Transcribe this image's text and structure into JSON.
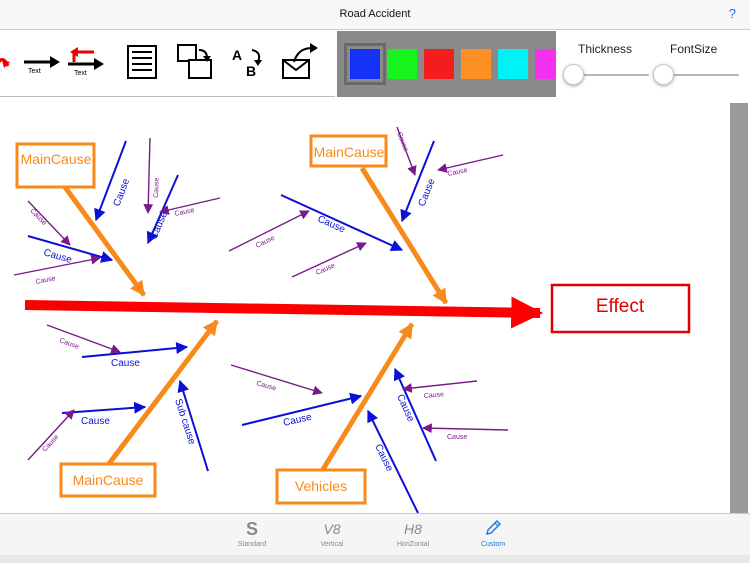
{
  "window": {
    "title": "Road Accident",
    "help": "?"
  },
  "toolbar": {
    "tools": [
      {
        "name": "red-arrow-tool"
      },
      {
        "name": "text-arrow-tool",
        "label": "Text"
      },
      {
        "name": "text-return-arrow-tool",
        "label": "Text"
      },
      {
        "name": "document-tool"
      },
      {
        "name": "resize-tool"
      },
      {
        "name": "spell-tool",
        "label_a": "A",
        "label_b": "B"
      },
      {
        "name": "export-tool"
      }
    ]
  },
  "palette": {
    "colors": [
      "#1432f5",
      "#17f31c",
      "#f41d1d",
      "#fd9024",
      "#00f3f4",
      "#f330ee"
    ],
    "selected": 0
  },
  "sliders": {
    "thickness": {
      "label": "Thickness",
      "value": 0.1
    },
    "fontsize": {
      "label": "FontSize",
      "value": 0.1
    }
  },
  "diagram": {
    "effect": "Effect",
    "main_causes": [
      "MainCause",
      "MainCause",
      "MainCause",
      "Vehicles"
    ],
    "cause_label": "Cause",
    "sub_cause_label": "Sub cause",
    "colors": {
      "spine": "#fa0000",
      "main": "#f88a1b",
      "cause": "#0a10d6",
      "sub": "#7a1a8a",
      "effect": "#e00000"
    }
  },
  "tabs": [
    {
      "label": "Standard",
      "glyph": "S"
    },
    {
      "label": "Vertical",
      "glyph": "V8"
    },
    {
      "label": "HoriZontal",
      "glyph": "H8"
    },
    {
      "label": "Custom",
      "active": true
    }
  ]
}
